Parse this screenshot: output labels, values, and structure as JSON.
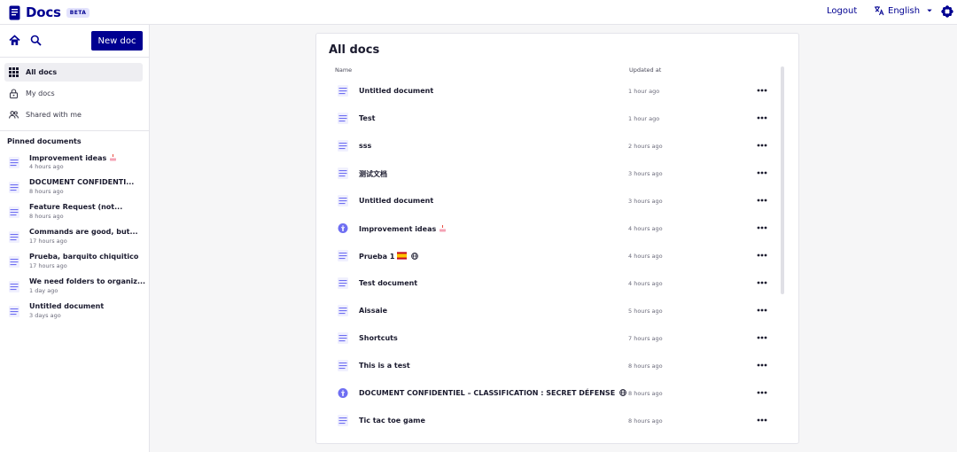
{
  "header": {
    "logo_text": "Docs",
    "beta_label": "BETA",
    "logout_label": "Logout",
    "language_label": "English"
  },
  "sidebar": {
    "new_doc_label": "New doc",
    "nav": [
      {
        "label": "All docs",
        "icon": "grid-icon",
        "active": true
      },
      {
        "label": "My docs",
        "icon": "lock-icon",
        "active": false
      },
      {
        "label": "Shared with me",
        "icon": "users-icon",
        "active": false
      }
    ],
    "pinned_title": "Pinned documents",
    "pinned": [
      {
        "title": "Improvement ideas",
        "time": "4 hours ago",
        "emoji": "cake-icon"
      },
      {
        "title": "DOCUMENT CONFIDENTI...",
        "time": "8 hours ago"
      },
      {
        "title": "Feature Request (not...",
        "time": "8 hours ago"
      },
      {
        "title": "Commands are good, but...",
        "time": "17 hours ago"
      },
      {
        "title": "Prueba, barquito chiquitico",
        "time": "17 hours ago"
      },
      {
        "title": "We need folders to organiz...",
        "time": "1 day ago"
      },
      {
        "title": "Untitled document",
        "time": "3 days ago"
      }
    ]
  },
  "main": {
    "title": "All docs",
    "columns": {
      "name": "Name",
      "updated": "Updated at"
    },
    "rows": [
      {
        "title": "Untitled document",
        "time": "1 hour ago",
        "icon": "doc-icon"
      },
      {
        "title": "Test",
        "time": "1 hour ago",
        "icon": "doc-icon"
      },
      {
        "title": "sss",
        "time": "2 hours ago",
        "icon": "doc-icon"
      },
      {
        "title": "测试文档",
        "time": "3 hours ago",
        "icon": "doc-icon"
      },
      {
        "title": "Untitled document",
        "time": "3 hours ago",
        "icon": "doc-icon"
      },
      {
        "title": "Improvement ideas",
        "time": "4 hours ago",
        "icon": "pinned-doc-icon",
        "emoji": "cake-icon"
      },
      {
        "title": "Prueba 1",
        "time": "4 hours ago",
        "icon": "doc-icon",
        "emoji": "spain-flag-icon",
        "globe": true
      },
      {
        "title": "Test document",
        "time": "4 hours ago",
        "icon": "doc-icon"
      },
      {
        "title": "Aissaie",
        "time": "5 hours ago",
        "icon": "doc-icon"
      },
      {
        "title": "Shortcuts",
        "time": "7 hours ago",
        "icon": "doc-icon"
      },
      {
        "title": "This is a test",
        "time": "8 hours ago",
        "icon": "doc-icon"
      },
      {
        "title": "DOCUMENT CONFIDENTIEL – CLASSIFICATION : SECRET DÉFENSE",
        "time": "8 hours ago",
        "icon": "pinned-doc-icon",
        "globe": true
      },
      {
        "title": "Tic tac toe game",
        "time": "8 hours ago",
        "icon": "doc-icon"
      }
    ]
  },
  "colors": {
    "brand": "#000091",
    "doc_icon": "#6e6ef2"
  }
}
